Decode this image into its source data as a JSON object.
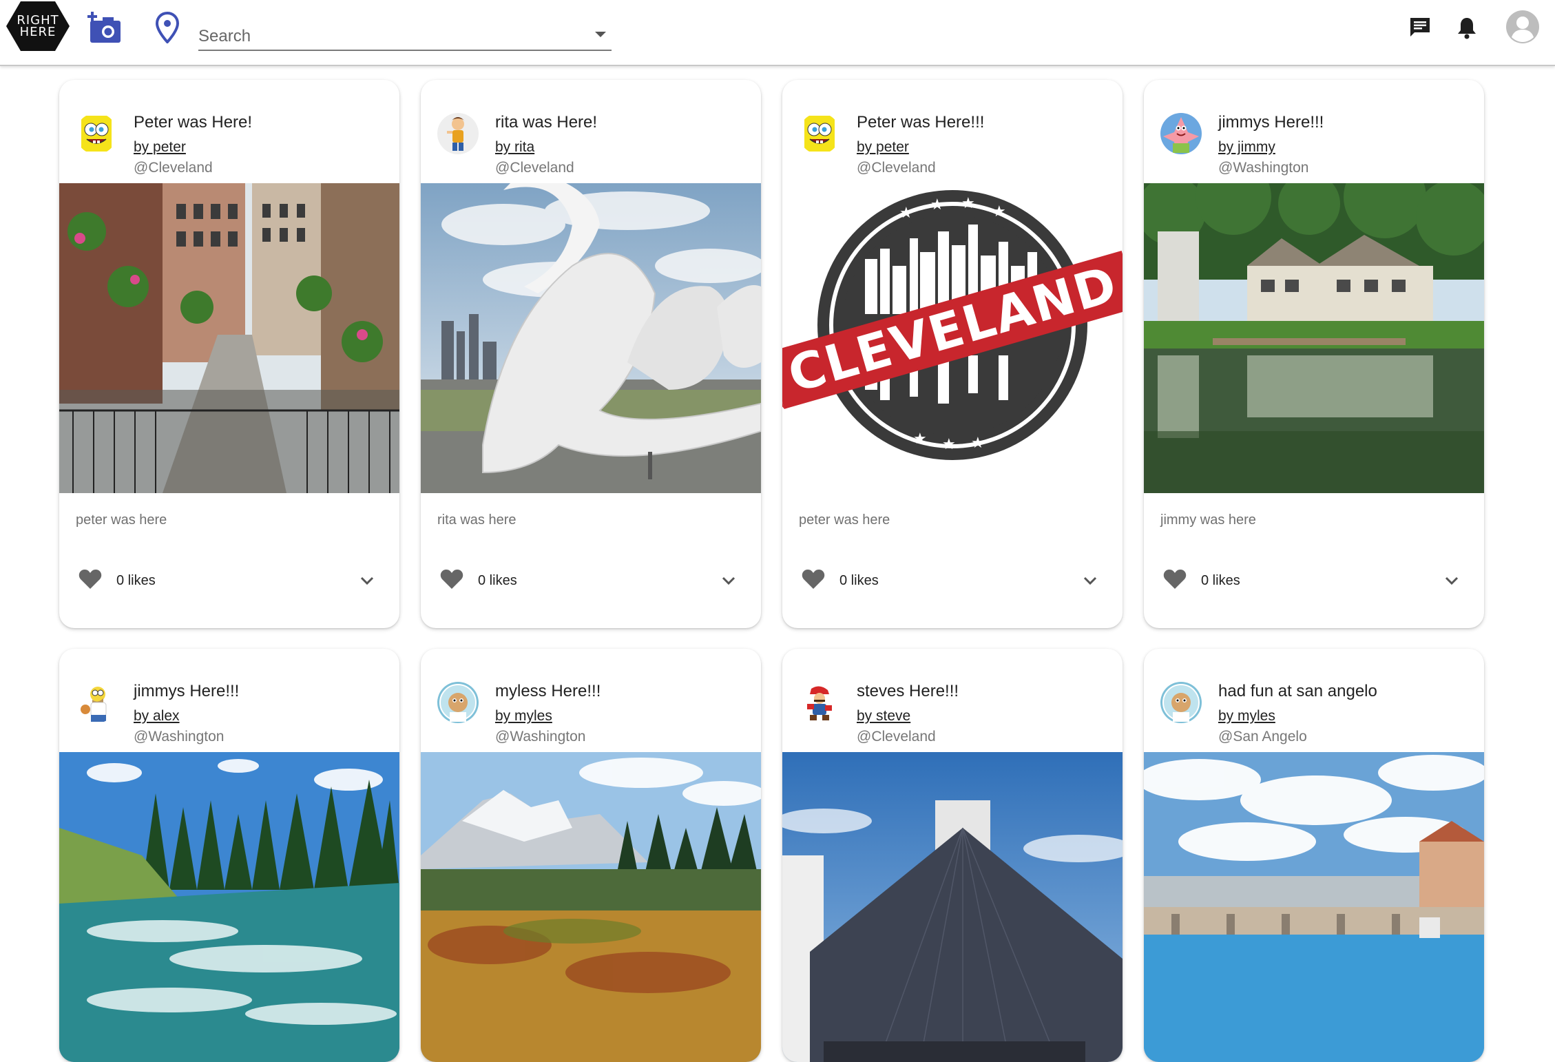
{
  "header": {
    "logo_line1": "RIGHT",
    "logo_line2": "HERE",
    "search_placeholder": "Search",
    "icons": [
      "add-photo-icon",
      "location-pin-icon",
      "chat-icon",
      "notification-bell-icon",
      "account-icon"
    ],
    "accent_color": "#3f51b5"
  },
  "posts": [
    {
      "title": "Peter was Here!",
      "author": "by peter",
      "location": "@Cleveland",
      "description": "peter was here",
      "likes": "0 likes",
      "avatar": "spongebob"
    },
    {
      "title": "rita was Here!",
      "author": "by rita",
      "location": "@Cleveland",
      "description": "rita was here",
      "likes": "0 likes",
      "avatar": "cartoon-kid"
    },
    {
      "title": "Peter was Here!!!",
      "author": "by peter",
      "location": "@Cleveland",
      "description": "peter was here",
      "likes": "0 likes",
      "avatar": "spongebob",
      "stamp_text": "CLEVELAND"
    },
    {
      "title": "jimmys Here!!!",
      "author": "by jimmy",
      "location": "@Washington",
      "description": "jimmy was here",
      "likes": "0 likes",
      "avatar": "patrick"
    },
    {
      "title": "jimmys Here!!!",
      "author": "by alex",
      "location": "@Washington",
      "avatar": "homer"
    },
    {
      "title": "myless Here!!!",
      "author": "by myles",
      "location": "@Washington",
      "avatar": "sandy"
    },
    {
      "title": "steves Here!!!",
      "author": "by steve",
      "location": "@Cleveland",
      "avatar": "mario"
    },
    {
      "title": "had fun at san angelo",
      "author": "by myles",
      "location": "@San Angelo",
      "avatar": "sandy"
    }
  ]
}
